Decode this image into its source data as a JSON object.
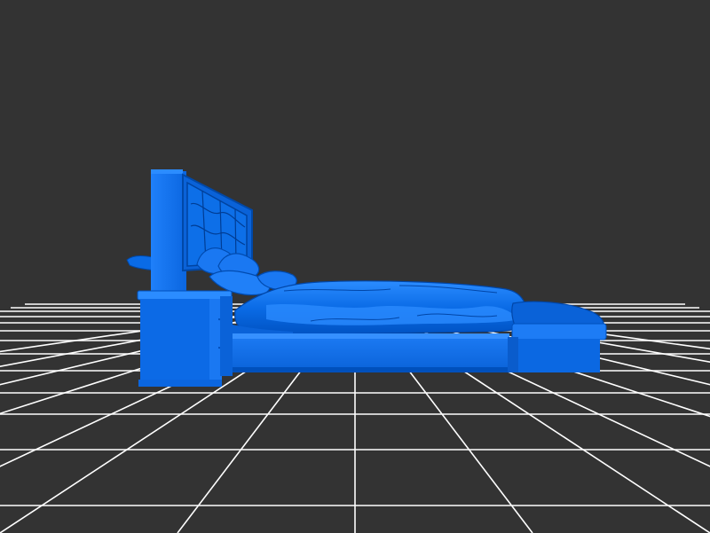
{
  "viewport": {
    "background_color": "#333333"
  },
  "grid": {
    "line_color": "#ffffff"
  },
  "model": {
    "name": "bed",
    "color": "#0a6be6",
    "highlight_color": "#2b8cff",
    "shadow_color": "#0048a8"
  }
}
